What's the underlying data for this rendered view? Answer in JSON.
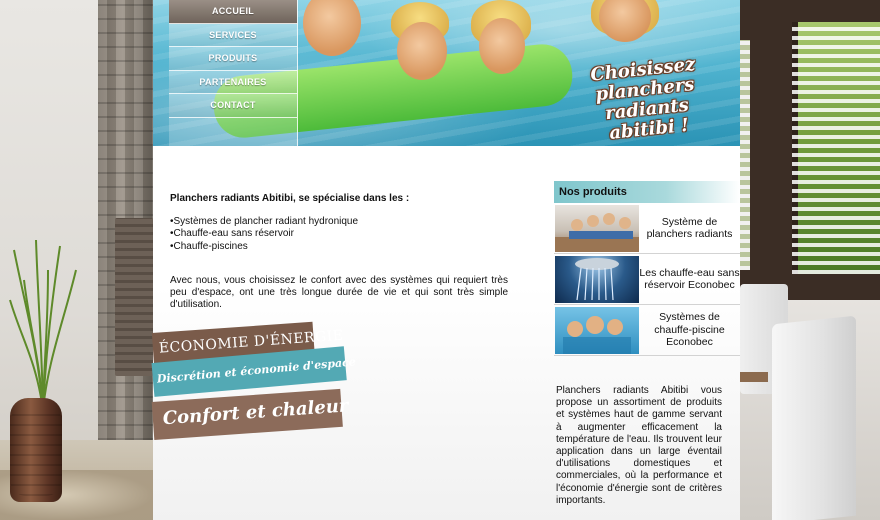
{
  "nav": {
    "items": [
      {
        "label": "ACCUEIL",
        "active": true
      },
      {
        "label": "SERVICES",
        "active": false
      },
      {
        "label": "PRODUITS",
        "active": false
      },
      {
        "label": "PARTENAIRES",
        "active": false
      },
      {
        "label": "CONTACT",
        "active": false
      }
    ]
  },
  "banner": {
    "slogan_line1": "Choisissez",
    "slogan_line2": "planchers radiants",
    "slogan_line3": "abitibi !"
  },
  "intro": {
    "title": "Planchers radiants Abitibi, se spécialise dans les :",
    "bullets": [
      "•Systèmes de plancher radiant hydronique",
      "•Chauffe-eau sans réservoir",
      "•Chauffe-piscines"
    ],
    "paragraph": "Avec nous, vous choisissez le confort avec des systèmes qui requiert très peu d'espace, ont une très longue durée de vie et qui sont très simple d'utilisation."
  },
  "ribbons": {
    "r1": "ÉCONOMIE D'ÉNERGIE",
    "r2": "Discrétion et économie d'espace",
    "r3": "Confort et chaleur"
  },
  "products": {
    "heading": "Nos produits",
    "items": [
      {
        "label": "Système de planchers radiants"
      },
      {
        "label": "Les chauffe-eau sans réservoir Econobec"
      },
      {
        "label": "Systèmes de chauffe-piscine Econobec"
      }
    ],
    "description": "Planchers radiants Abitibi vous propose un assortiment de produits et systèmes haut de gamme servant à augmenter efficacement la température de l'eau. Ils trouvent leur application dans un large éventail d'utilisations domestiques et commerciales, où la performance et l'économie d'énergie sont de critères importants."
  },
  "colors": {
    "nav_active": "#7d7269",
    "products_heading": "#7fc6cc",
    "ribbon_brown": "#7a5b4a",
    "ribbon_teal": "#53a9b4"
  }
}
